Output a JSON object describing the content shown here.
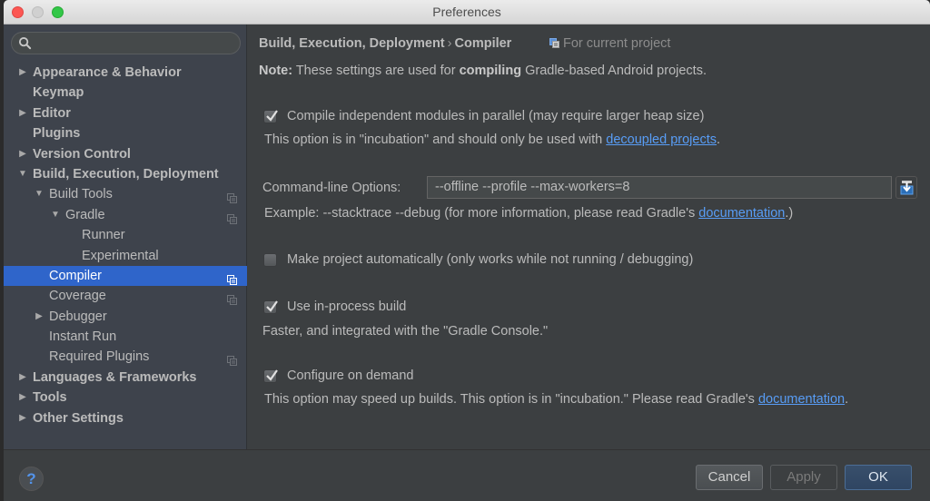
{
  "window": {
    "title": "Preferences"
  },
  "sidebar": {
    "search": {
      "value": "",
      "placeholder": ""
    },
    "items": [
      {
        "label": "Appearance & Behavior",
        "level": 0,
        "arrow": "collapsed",
        "bold": true,
        "project_icon": false,
        "selected": false
      },
      {
        "label": "Keymap",
        "level": 0,
        "arrow": "none",
        "bold": true,
        "project_icon": false,
        "selected": false
      },
      {
        "label": "Editor",
        "level": 0,
        "arrow": "collapsed",
        "bold": true,
        "project_icon": false,
        "selected": false
      },
      {
        "label": "Plugins",
        "level": 0,
        "arrow": "none",
        "bold": true,
        "project_icon": false,
        "selected": false
      },
      {
        "label": "Version Control",
        "level": 0,
        "arrow": "collapsed",
        "bold": true,
        "project_icon": false,
        "selected": false
      },
      {
        "label": "Build, Execution, Deployment",
        "level": 0,
        "arrow": "expanded",
        "bold": true,
        "project_icon": false,
        "selected": false
      },
      {
        "label": "Build Tools",
        "level": 1,
        "arrow": "expanded",
        "bold": false,
        "project_icon": true,
        "selected": false
      },
      {
        "label": "Gradle",
        "level": 2,
        "arrow": "expanded",
        "bold": false,
        "project_icon": true,
        "selected": false
      },
      {
        "label": "Runner",
        "level": 3,
        "arrow": "none",
        "bold": false,
        "project_icon": false,
        "selected": false
      },
      {
        "label": "Experimental",
        "level": 3,
        "arrow": "none",
        "bold": false,
        "project_icon": false,
        "selected": false
      },
      {
        "label": "Compiler",
        "level": 1,
        "arrow": "none",
        "bold": false,
        "project_icon": true,
        "selected": true
      },
      {
        "label": "Coverage",
        "level": 1,
        "arrow": "none",
        "bold": false,
        "project_icon": true,
        "selected": false
      },
      {
        "label": "Debugger",
        "level": 1,
        "arrow": "collapsed",
        "bold": false,
        "project_icon": false,
        "selected": false
      },
      {
        "label": "Instant Run",
        "level": 1,
        "arrow": "none",
        "bold": false,
        "project_icon": false,
        "selected": false
      },
      {
        "label": "Required Plugins",
        "level": 1,
        "arrow": "none",
        "bold": false,
        "project_icon": true,
        "selected": false
      },
      {
        "label": "Languages & Frameworks",
        "level": 0,
        "arrow": "collapsed",
        "bold": true,
        "project_icon": false,
        "selected": false
      },
      {
        "label": "Tools",
        "level": 0,
        "arrow": "collapsed",
        "bold": true,
        "project_icon": false,
        "selected": false
      },
      {
        "label": "Other Settings",
        "level": 0,
        "arrow": "collapsed",
        "bold": true,
        "project_icon": false,
        "selected": false
      }
    ]
  },
  "content": {
    "breadcrumb": {
      "parent": "Build, Execution, Deployment",
      "separator": "›",
      "current": "Compiler",
      "scope": "For current project"
    },
    "note": {
      "prefix": "Note:",
      "text1": " These settings are used for ",
      "bold": "compiling",
      "text2": " Gradle-based Android projects."
    },
    "options": {
      "parallel": {
        "label": "Compile independent modules in parallel (may require larger heap size)",
        "checked": true,
        "hint_text": "This option is in \"incubation\" and should only be used with ",
        "hint_link": "decoupled projects",
        "hint_end": "."
      },
      "cmdline": {
        "label": "Command-line Options:",
        "value": "--offline --profile --max-workers=8",
        "hint_text": "Example: --stacktrace --debug (for more information, please read Gradle's ",
        "hint_link": "documentation",
        "hint_end": ".)"
      },
      "auto_make": {
        "label": "Make project automatically (only works while not running / debugging)",
        "checked": false
      },
      "in_process": {
        "label": "Use in-process build",
        "checked": true,
        "hint_text": "Faster, and integrated with the \"Gradle Console.\""
      },
      "configure_on_demand": {
        "label": "Configure on demand",
        "checked": true,
        "hint_text": "This option may speed up builds. This option is in \"incubation.\" Please read Gradle's ",
        "hint_link": "documentation",
        "hint_end": "."
      }
    }
  },
  "footer": {
    "help_label": "?",
    "cancel_label": "Cancel",
    "apply_label": "Apply",
    "ok_label": "OK"
  },
  "colors": {
    "selection": "#2f65ca",
    "link": "#589df6",
    "sidebar_bg": "#3e434c",
    "content_bg": "#3c3f41"
  }
}
